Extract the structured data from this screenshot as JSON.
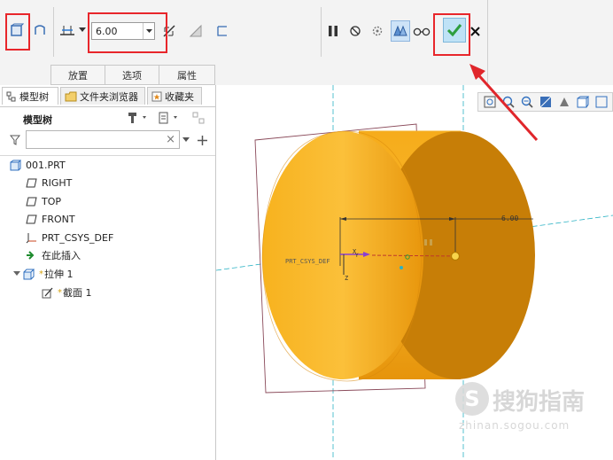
{
  "dashboard": {
    "depth_value": "6.00",
    "tabs": [
      "放置",
      "选项",
      "属性"
    ]
  },
  "left_panel": {
    "tabs": [
      "模型树",
      "文件夹浏览器",
      "收藏夹"
    ],
    "tree_title": "模型树",
    "search_placeholder": "",
    "items": [
      {
        "label": "001.PRT",
        "icon": "part-icon"
      },
      {
        "label": "RIGHT",
        "icon": "datum-plane-icon"
      },
      {
        "label": "TOP",
        "icon": "datum-plane-icon"
      },
      {
        "label": "FRONT",
        "icon": "datum-plane-icon"
      },
      {
        "label": "PRT_CSYS_DEF",
        "icon": "csys-icon"
      },
      {
        "label": "在此插入",
        "icon": "insert-here-icon"
      },
      {
        "label": "拉伸 1",
        "icon": "extrude-icon",
        "marker": "*"
      },
      {
        "label": "截面 1",
        "icon": "sketch-icon",
        "marker": "*"
      }
    ]
  },
  "viewport": {
    "dimension_label": "6.00",
    "csys_label": "PRT_CSYS_DEF",
    "axis_x": "X",
    "axis_y": "Y",
    "axis_z": "Z",
    "model_color": "#f2a412"
  },
  "watermark": {
    "brand": "搜狗指南",
    "url": "zhinan.sogou.com"
  },
  "colors": {
    "highlight_box": "#e8262b",
    "confirm_green": "#2e9e3e",
    "arrow_red": "#e0262b"
  }
}
